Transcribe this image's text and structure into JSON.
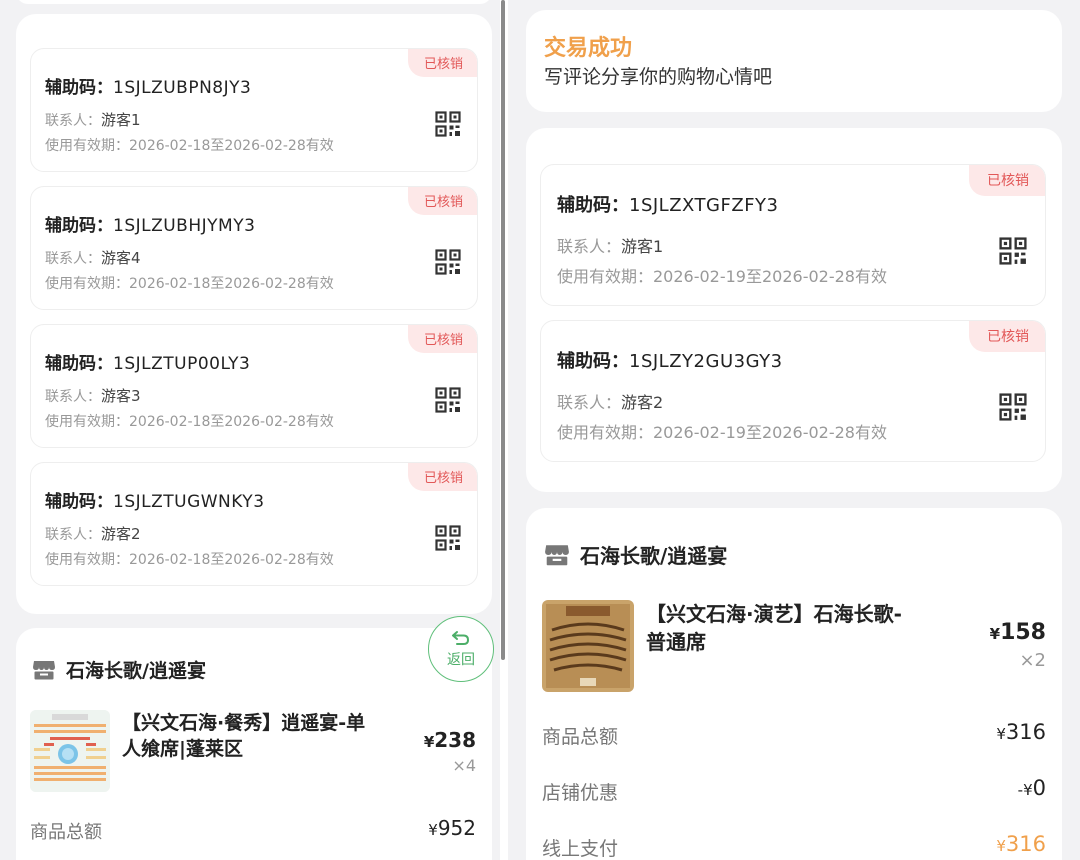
{
  "left": {
    "tickets": [
      {
        "badge": "已核销",
        "code_label": "辅助码：",
        "code": "1SJLZUBPN8JY3",
        "contact_label": "联系人：",
        "contact": "游客1",
        "validity": "使用有效期：2026-02-18至2026-02-28有效"
      },
      {
        "badge": "已核销",
        "code_label": "辅助码：",
        "code": "1SJLZUBHJYMY3",
        "contact_label": "联系人：",
        "contact": "游客4",
        "validity": "使用有效期：2026-02-18至2026-02-28有效"
      },
      {
        "badge": "已核销",
        "code_label": "辅助码：",
        "code": "1SJLZTUP00LY3",
        "contact_label": "联系人：",
        "contact": "游客3",
        "validity": "使用有效期：2026-02-18至2026-02-28有效"
      },
      {
        "badge": "已核销",
        "code_label": "辅助码：",
        "code": "1SJLZTUGWNKY3",
        "contact_label": "联系人：",
        "contact": "游客2",
        "validity": "使用有效期：2026-02-18至2026-02-28有效"
      }
    ],
    "store_name": "石海长歌/逍遥宴",
    "product": {
      "title_line1": "【兴文石海·餐秀】逍遥宴-单",
      "title_line2": "人飨席|蓬莱区",
      "currency": "¥",
      "price": "238",
      "qty": "×4"
    },
    "summary": [
      {
        "label": "商品总额",
        "currency": "¥",
        "value": "952"
      }
    ],
    "return_button": "返回"
  },
  "right": {
    "status_title": "交易成功",
    "status_sub": "写评论分享你的购物心情吧",
    "tickets": [
      {
        "badge": "已核销",
        "code_label": "辅助码：",
        "code": "1SJLZXTGFZFY3",
        "contact_label": "联系人：",
        "contact": "游客1",
        "validity": "使用有效期：2026-02-19至2026-02-28有效"
      },
      {
        "badge": "已核销",
        "code_label": "辅助码：",
        "code": "1SJLZY2GU3GY3",
        "contact_label": "联系人：",
        "contact": "游客2",
        "validity": "使用有效期：2026-02-19至2026-02-28有效"
      }
    ],
    "store_name": "石海长歌/逍遥宴",
    "product": {
      "title_line1": "【兴文石海·演艺】石海长歌-",
      "title_line2": "普通席",
      "currency": "¥",
      "price": "158",
      "qty": "×2"
    },
    "summary": [
      {
        "label": "商品总额",
        "currency": "¥",
        "value": "316"
      },
      {
        "label": "店铺优惠",
        "currency": "-¥",
        "value": "0"
      },
      {
        "label": "线上支付",
        "currency": "¥",
        "value": "316"
      }
    ]
  },
  "colors": {
    "accent_orange": "#f0a04b",
    "badge_red": "#e25858",
    "badge_bg": "#fde8e8",
    "return_green": "#4cae68"
  },
  "icons": {
    "ticket_qr": "qr-code-icon",
    "store": "store-icon",
    "return": "return-arrow-icon"
  }
}
